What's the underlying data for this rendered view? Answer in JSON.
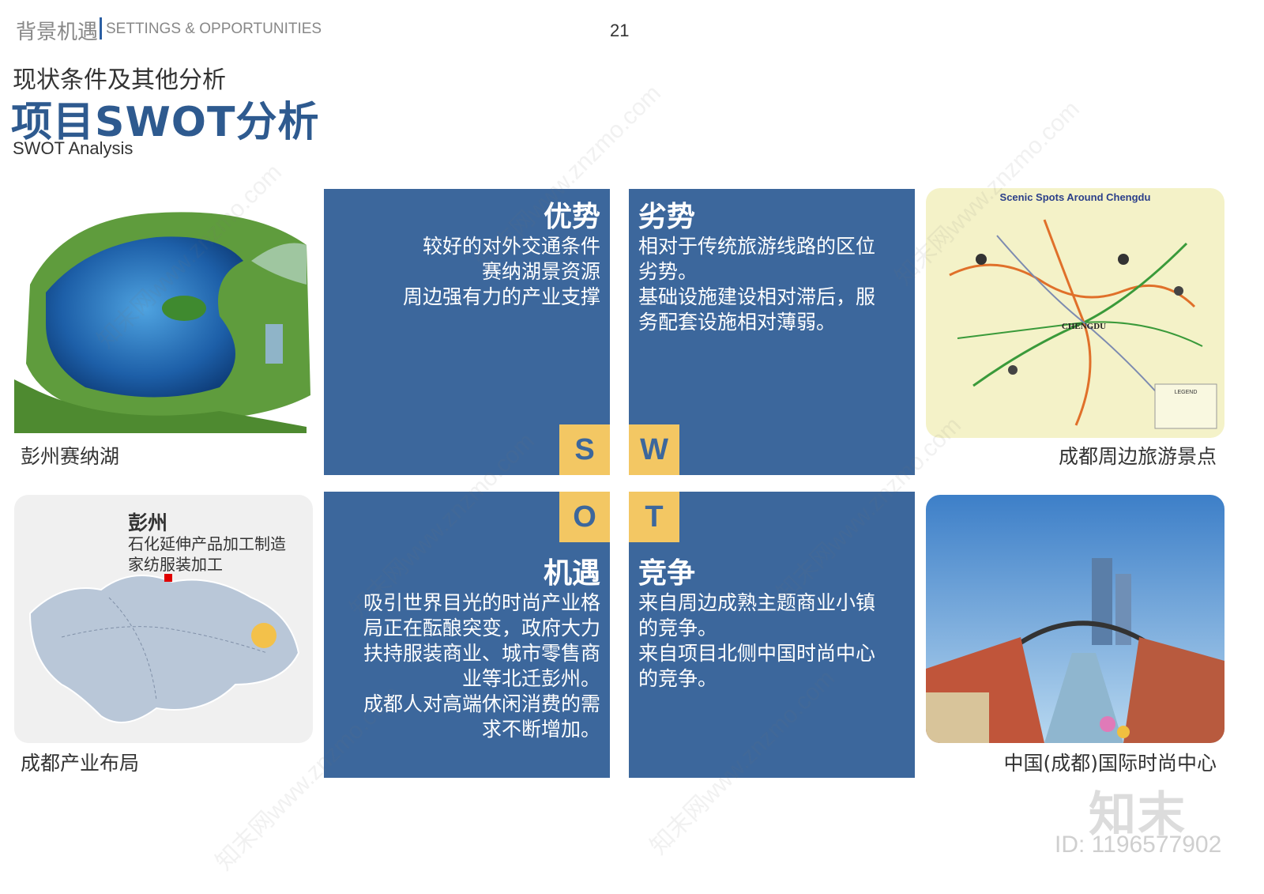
{
  "header": {
    "section_cn": "背景机遇",
    "section_en": "SETTINGS & OPPORTUNITIES",
    "page_number": "21"
  },
  "subtitle": "现状条件及其他分析",
  "title": "项目SWOT分析",
  "title_en": "SWOT Analysis",
  "swot": {
    "s": {
      "letter": "S",
      "heading": "优势",
      "lines": [
        "较好的对外交通条件",
        "赛纳湖景资源",
        "周边强有力的产业支撑"
      ]
    },
    "w": {
      "letter": "W",
      "heading": "劣势",
      "lines": [
        "相对于传统旅游线路的区位",
        "劣势。",
        "基础设施建设相对滞后，服",
        "务配套设施相对薄弱。"
      ]
    },
    "o": {
      "letter": "O",
      "heading": "机遇",
      "lines": [
        "吸引世界目光的时尚产业格",
        "局正在酝酿突变，政府大力",
        "扶持服装商业、城市零售商",
        "业等北迁彭州。",
        "成都人对高端休闲消费的需",
        "求不断增加。"
      ]
    },
    "t": {
      "letter": "T",
      "heading": "竞争",
      "lines": [
        "来自周边成熟主题商业小镇",
        "的竞争。",
        "来自项目北侧中国时尚中心",
        "的竞争。"
      ]
    }
  },
  "images": {
    "lake": {
      "caption": "彭州赛纳湖"
    },
    "map": {
      "caption": "成都周边旅游景点",
      "map_title": "Scenic Spots Around Chengdu",
      "city_label": "CHENGDU",
      "legend_label": "LEGEND"
    },
    "industry": {
      "caption": "成都产业布局",
      "region_name": "彭州",
      "line1": "石化延伸产品加工制造",
      "line2": "家纺服装加工"
    },
    "fashion": {
      "caption": "中国(成都)国际时尚中心"
    }
  },
  "watermark": {
    "text": "知末网www.znzmo.com",
    "logo": "知末",
    "id": "ID: 1196577902"
  },
  "colors": {
    "quad_blue": "#3c679c",
    "letter_yellow": "#f3c763",
    "title_blue": "#2e5a8f"
  }
}
